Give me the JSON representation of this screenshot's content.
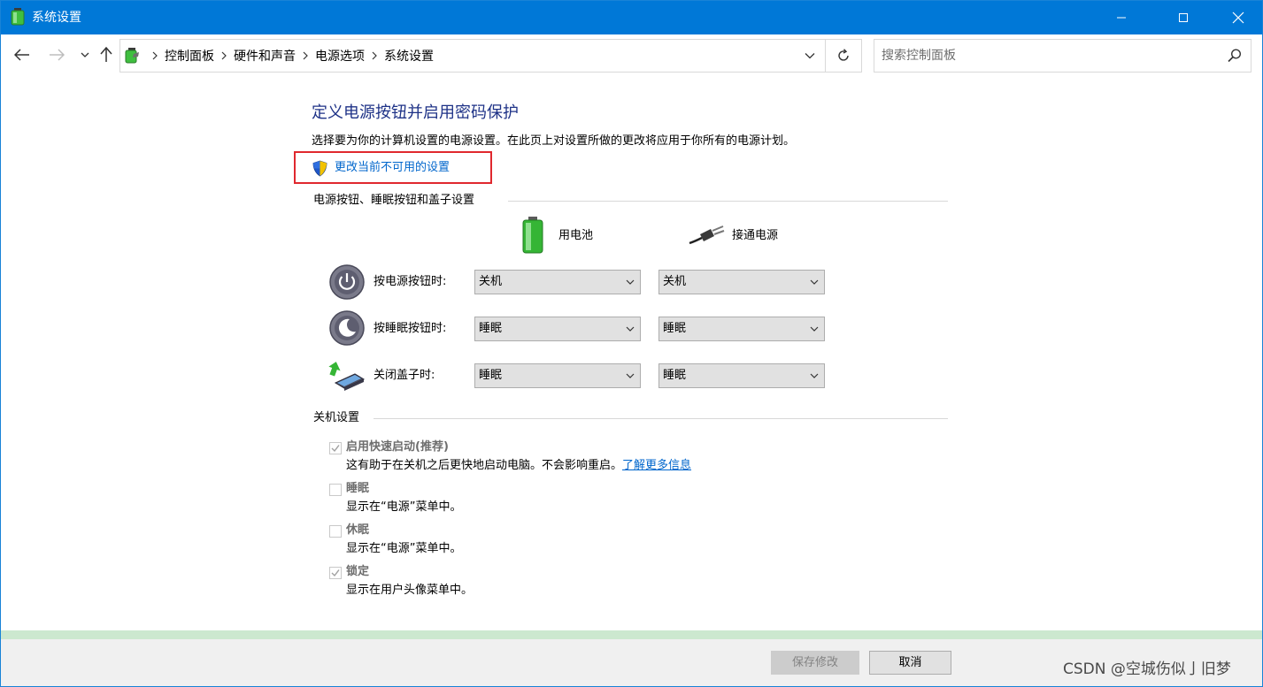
{
  "window": {
    "title": "系统设置"
  },
  "address": {
    "crumbs": [
      "控制面板",
      "硬件和声音",
      "电源选项",
      "系统设置"
    ]
  },
  "search": {
    "placeholder": "搜索控制面板"
  },
  "page": {
    "heading": "定义电源按钮并启用密码保护",
    "description": "选择要为你的计算机设置的电源设置。在此页上对设置所做的更改将应用于你所有的电源计划。",
    "admin_link": "更改当前不可用的设置"
  },
  "power_section": {
    "title": "电源按钮、睡眠按钮和盖子设置",
    "col_battery": "用电池",
    "col_plugged": "接通电源",
    "rows": [
      {
        "label": "按电源按钮时:",
        "battery": "关机",
        "plugged": "关机",
        "icon": "power-button-icon"
      },
      {
        "label": "按睡眠按钮时:",
        "battery": "睡眠",
        "plugged": "睡眠",
        "icon": "sleep-button-icon"
      },
      {
        "label": "关闭盖子时:",
        "battery": "睡眠",
        "plugged": "睡眠",
        "icon": "laptop-lid-icon"
      }
    ]
  },
  "shutdown_section": {
    "title": "关机设置",
    "options": [
      {
        "title": "启用快速启动(推荐)",
        "desc": "这有助于在关机之后更快地启动电脑。不会影响重启。",
        "link": "了解更多信息",
        "checked": true
      },
      {
        "title": "睡眠",
        "desc": "显示在“电源”菜单中。",
        "checked": false
      },
      {
        "title": "休眠",
        "desc": "显示在“电源”菜单中。",
        "checked": false
      },
      {
        "title": "锁定",
        "desc": "显示在用户头像菜单中。",
        "checked": true
      }
    ]
  },
  "footer": {
    "save": "保存修改",
    "cancel": "取消",
    "watermark": "CSDN @空城伤似亅旧梦"
  },
  "colors": {
    "titlebar": "#0078d7",
    "heading": "#1e3287",
    "link": "#0066cc",
    "highlight_box": "#e0282e",
    "footer_stripe": "#cce8cf"
  }
}
